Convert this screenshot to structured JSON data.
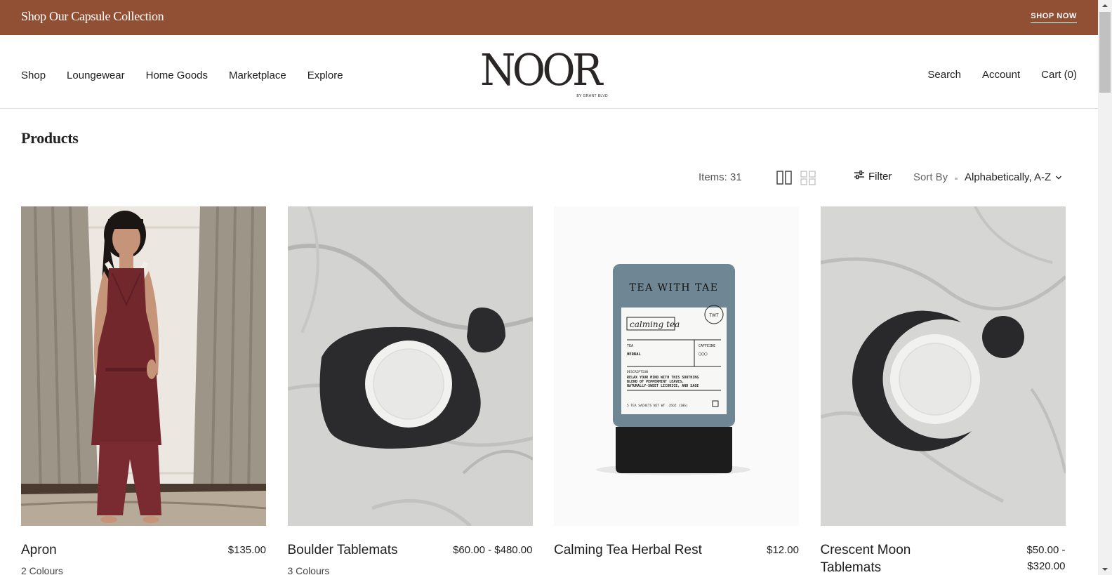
{
  "announcement": {
    "text": "Shop Our Capsule Collection",
    "cta": "SHOP NOW"
  },
  "brand": {
    "name": "NOOR",
    "tagline": "BY GRANT BLVD",
    "accent": "#914f34"
  },
  "nav": {
    "left": [
      "Shop",
      "Loungewear",
      "Home Goods",
      "Marketplace",
      "Explore"
    ],
    "right": [
      "Search",
      "Account",
      "Cart (0)"
    ]
  },
  "page": {
    "title": "Products"
  },
  "toolbar": {
    "items": "Items: 31",
    "filter": "Filter",
    "sort_label": "Sort By",
    "sort_value": "Alphabetically, A-Z",
    "view_icons": [
      "grid-2-columns-icon",
      "grid-4-columns-icon"
    ]
  },
  "products": [
    {
      "name": "Apron",
      "price": "$135.00",
      "variants": "2 Colours"
    },
    {
      "name": "Boulder Tablemats",
      "price": "$60.00 - $480.00",
      "variants": "3 Colours"
    },
    {
      "name": "Calming Tea Herbal Rest",
      "price": "$12.00"
    },
    {
      "name": "Crescent Moon Tablemats",
      "price": "$50.00 - $320.00"
    }
  ],
  "tea_label": {
    "brand": "TEA WITH TAE",
    "script": "calming tea",
    "seal": "TWT",
    "type_label": "TEA",
    "type_value": "HERBAL",
    "caffeine_label": "CAFFEINE",
    "caffeine_value": "○○○",
    "desc_label": "DESCRIPTION",
    "desc_1": "RELAX YOUR MIND WITH THIS SOOTHING",
    "desc_2": "BLEND OF PEPPERMINT LEAVES,",
    "desc_3": "NATURALLY-SWEET LICORICE, AND SAGE",
    "weight": "5 TEA SACHETS NET WT .35OZ (10G)"
  }
}
